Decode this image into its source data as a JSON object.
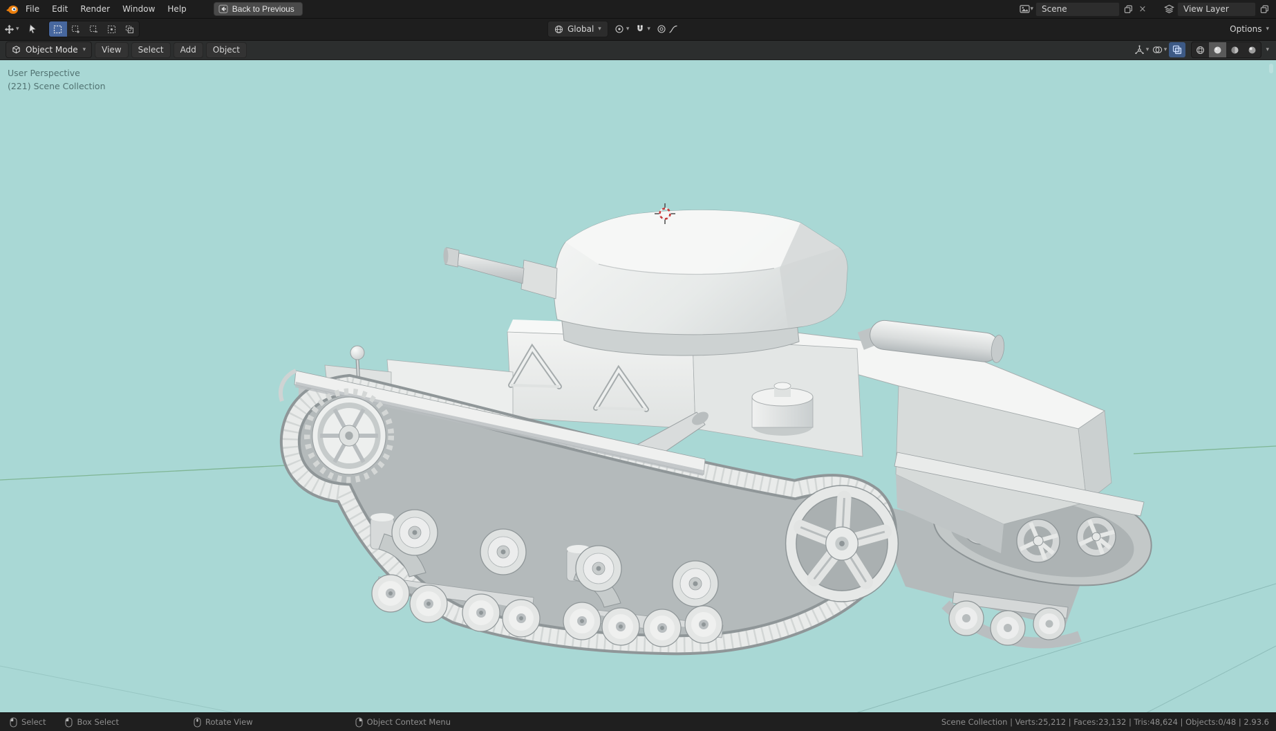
{
  "topbar": {
    "menus": [
      "File",
      "Edit",
      "Render",
      "Window",
      "Help"
    ],
    "back_button_label": "Back to Previous",
    "scene": {
      "value": "Scene"
    },
    "view_layer": {
      "value": "View Layer"
    }
  },
  "tool_settings": {
    "transform_orientation": "Global",
    "options_label": "Options"
  },
  "viewport_header": {
    "mode": "Object Mode",
    "menus": [
      "View",
      "Select",
      "Add",
      "Object"
    ]
  },
  "viewport": {
    "overlay": {
      "line1": "User Perspective",
      "line2": "(221) Scene Collection"
    },
    "background_color": "#a9d8d5",
    "model_base_color": "#e9ebea"
  },
  "statusbar": {
    "hints": [
      {
        "icon": "mouse-left",
        "label": "Select"
      },
      {
        "icon": "mouse-left-drag",
        "label": "Box Select"
      },
      {
        "icon": "mouse-middle",
        "label": "Rotate View"
      },
      {
        "icon": "mouse-right",
        "label": "Object Context Menu"
      }
    ],
    "stats": "Scene Collection | Verts:25,212 | Faces:23,132 | Tris:48,624 | Objects:0/48 | 2.93.6"
  },
  "icons": {
    "blender-logo": "orange-blender-mark",
    "back-arrow-icon": "left-arrow",
    "scene-icon": "scene-picture",
    "copy-icon": "duplicate",
    "unlink-icon": "x",
    "view-layer-icon": "stacked-layers",
    "editor-type-icon": "move-arrows",
    "cursor-tool-icon": "pointer-arrow",
    "select-box-icon": "dashed-square",
    "orientation-icon": "globe",
    "pivot-icon": "concentric-circles",
    "snap-magnet-icon": "magnet",
    "proportional-icon": "circle-dot",
    "falloff-curve-icon": "curve",
    "gizmo-icon": "axis-gizmo",
    "overlays-icon": "two-circles",
    "xray-icon": "overlapping-squares",
    "shading-wireframe-icon": "wire-sphere",
    "shading-solid-icon": "solid-sphere",
    "shading-material-icon": "half-sphere",
    "shading-rendered-icon": "lit-sphere"
  },
  "colors": {
    "accent": "#4772b3",
    "header_bg": "#1d1d1d",
    "viewport_bg": "#a9d8d5"
  }
}
